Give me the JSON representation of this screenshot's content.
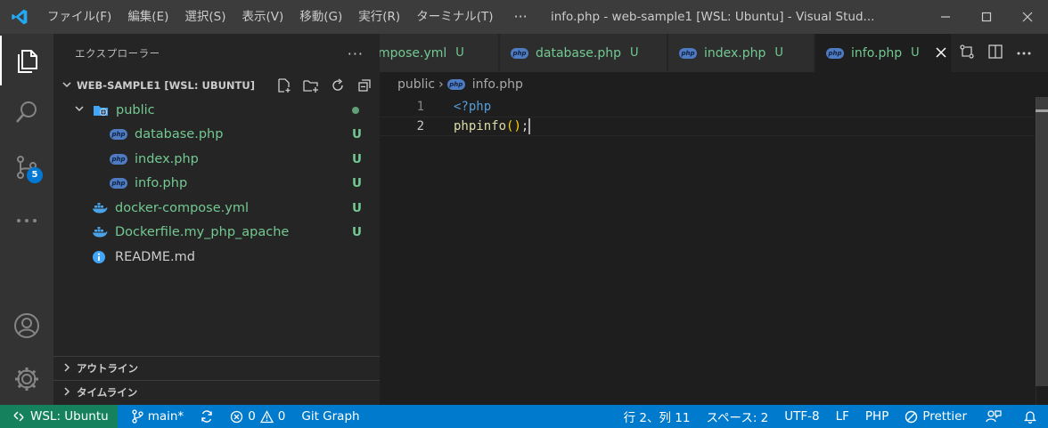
{
  "titlebar": {
    "menu": [
      "ファイル(F)",
      "編集(E)",
      "選択(S)",
      "表示(V)",
      "移動(G)",
      "実行(R)",
      "ターミナル(T)"
    ],
    "more": "···",
    "title": "info.php - web-sample1 [WSL: Ubuntu] - Visual Stud..."
  },
  "activitybar": {
    "scm_badge": "5"
  },
  "sidebar": {
    "title": "エクスプローラー",
    "more": "···",
    "workspace": "WEB-SAMPLE1 [WSL: UBUNTU]",
    "tree": [
      {
        "label": "public",
        "icon": "folder-globe-icon",
        "status": "dot"
      },
      {
        "label": "database.php",
        "icon": "php-icon",
        "status": "U"
      },
      {
        "label": "index.php",
        "icon": "php-icon",
        "status": "U"
      },
      {
        "label": "info.php",
        "icon": "php-icon",
        "status": "U"
      },
      {
        "label": "docker-compose.yml",
        "icon": "docker-icon",
        "status": "U"
      },
      {
        "label": "Dockerfile.my_php_apache",
        "icon": "docker-icon",
        "status": "U"
      },
      {
        "label": "README.md",
        "icon": "info-icon",
        "status": ""
      }
    ],
    "outline": "アウトライン",
    "timeline": "タイムライン"
  },
  "tabs": [
    {
      "label": "mpose.yml",
      "status": "U"
    },
    {
      "label": "database.php",
      "status": "U"
    },
    {
      "label": "index.php",
      "status": "U"
    },
    {
      "label": "info.php",
      "status": "U",
      "active": true
    }
  ],
  "breadcrumb": {
    "folder": "public",
    "sep": "›",
    "file": "info.php"
  },
  "code": {
    "line1_no": "1",
    "line2_no": "2",
    "line1": "<?php",
    "line2_fn": "phpinfo",
    "line2_open": "(",
    "line2_close": ")",
    "line2_end": ";"
  },
  "statusbar": {
    "remote": "WSL: Ubuntu",
    "branch": "main*",
    "errors": "0",
    "warnings": "0",
    "git_graph": "Git Graph",
    "position": "行 2、列 11",
    "spaces": "スペース: 2",
    "encoding": "UTF-8",
    "eol": "LF",
    "language": "PHP",
    "prettier": "Prettier"
  },
  "colors": {
    "accent": "#007acc",
    "remote": "#16825d",
    "git_untracked": "#73c991"
  }
}
